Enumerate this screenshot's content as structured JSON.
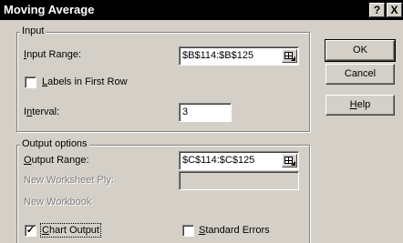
{
  "window": {
    "title": "Moving Average",
    "help_glyph": "?",
    "close_glyph": "X"
  },
  "input_group": {
    "title": "Input",
    "input_range_label": "Input Range:",
    "input_range_value": "$B$114:$B$125",
    "labels_first_row_label": "Labels in First Row",
    "labels_first_row_checked": false,
    "interval_label": "Interval:",
    "interval_value": "3"
  },
  "output_group": {
    "title": "Output options",
    "output_range_label": "Output Range:",
    "output_range_value": "$C$114:$C$125",
    "new_ply_label": "New Worksheet Ply:",
    "new_ply_value": "",
    "new_workbook_label": "New Workbook",
    "chart_output_label": "Chart Output",
    "chart_output_checked": true,
    "standard_errors_label": "Standard Errors",
    "standard_errors_checked": false
  },
  "buttons": {
    "ok": "OK",
    "cancel": "Cancel",
    "help": "Help"
  },
  "colors": {
    "dialog_bg": "#d4d0c8",
    "titlebar_bg": "#000000",
    "titlebar_text": "#ffffff",
    "disabled_text": "#808080"
  },
  "icons": {
    "range_picker": "range-picker-icon",
    "check": "checkmark-icon"
  }
}
